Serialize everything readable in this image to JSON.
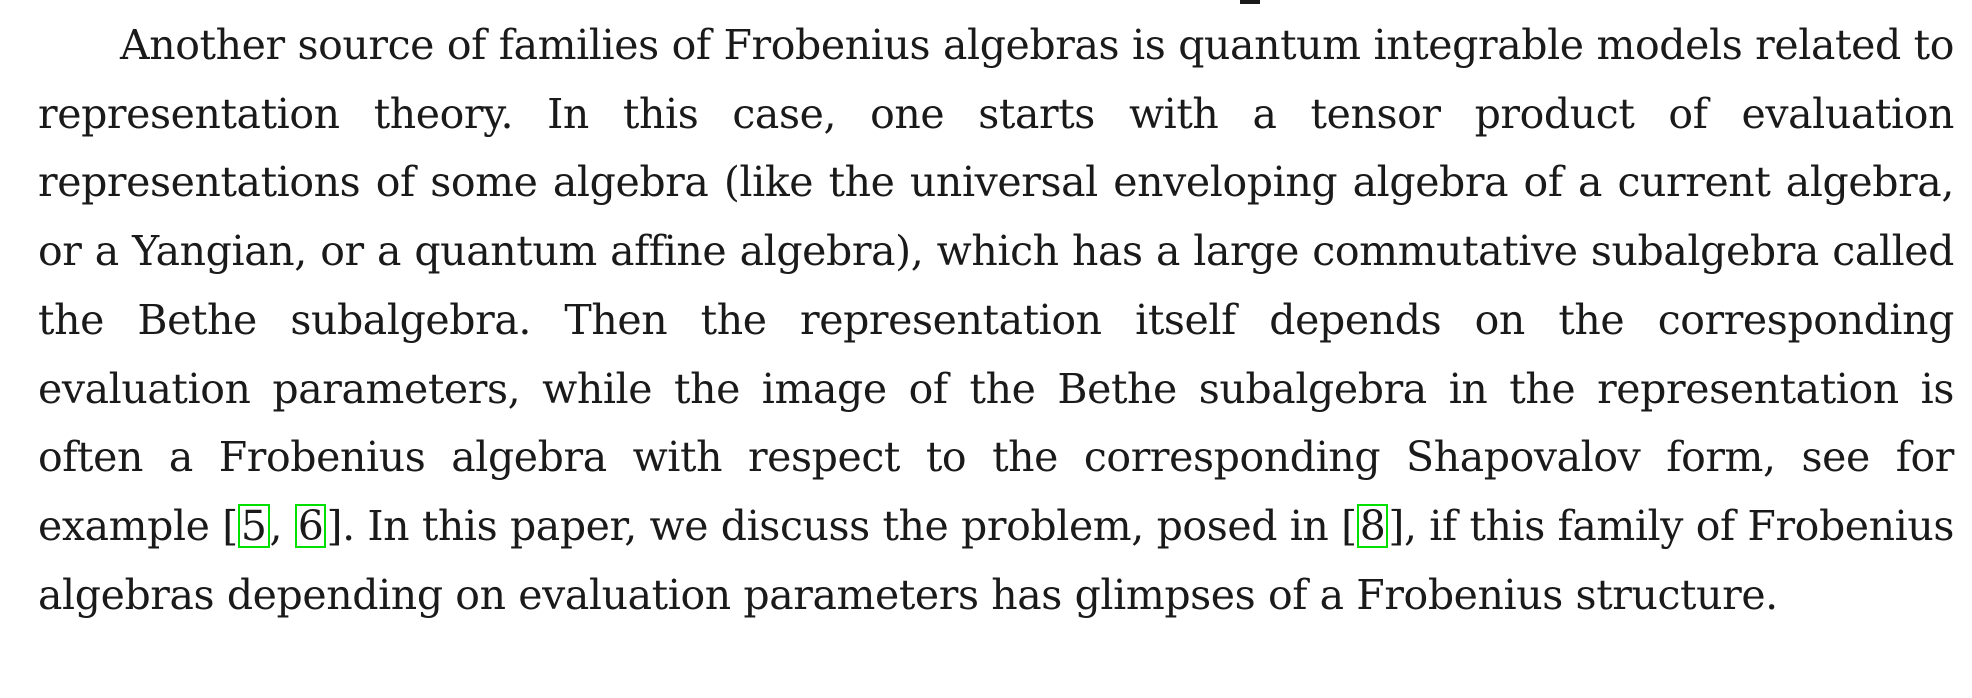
{
  "paragraph": {
    "seg1": "Another source of families of Frobenius algebras is quantum integrable models related to representation theory. In this case, one starts with a tensor product of evaluation representations of some algebra (like the universal enveloping algebra of a current algebra, or a Yangian, or a quantum affine algebra), which has a large commutative subalgebra called the Bethe subalgebra. Then the representation itself depends on the corresponding evaluation parameters, while the image of the Bethe subalgebra in the representation is often a Frobenius algebra with respect to the corresponding Shapovalov form, see for example ",
    "bracket_open_1": "[",
    "cite_1": "5",
    "comma": ", ",
    "cite_2": "6",
    "bracket_close_1": "]",
    "seg2": ". In this paper, we discuss the problem, posed in ",
    "bracket_open_2": "[",
    "cite_3": "8",
    "bracket_close_2": "]",
    "seg3": ", if this family of Frobenius algebras depending on evaluation parameters has glimpses of a Frobenius structure."
  },
  "colors": {
    "text": "#1a1a1a",
    "citation_border": "#00e000",
    "background": "#ffffff"
  }
}
